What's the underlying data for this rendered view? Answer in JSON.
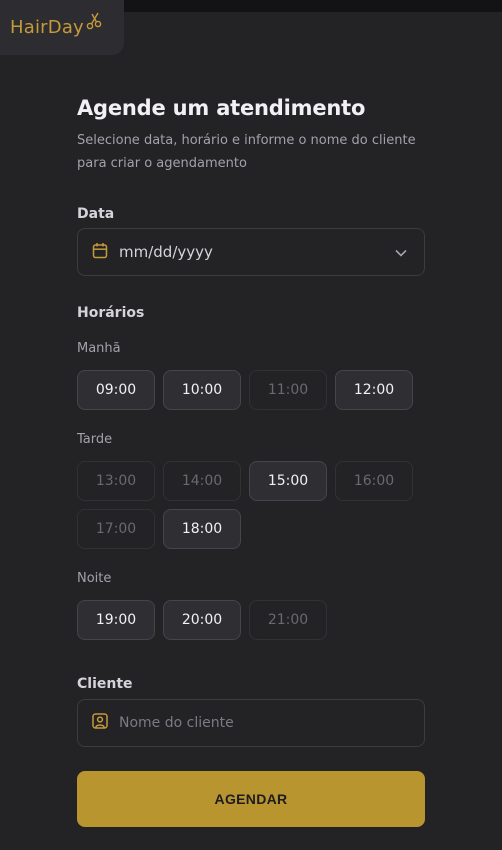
{
  "app": {
    "logo_text": "HairDay"
  },
  "form": {
    "title": "Agende um atendimento",
    "subtitle": "Selecione data, horário e informe o nome do cliente para criar o agendamento",
    "date": {
      "label": "Data",
      "value": "mm/dd/yyyy"
    },
    "hours_label": "Horários",
    "periods": {
      "morning": {
        "label": "Manhã",
        "slots": [
          {
            "time": "09:00",
            "available": true
          },
          {
            "time": "10:00",
            "available": true
          },
          {
            "time": "11:00",
            "available": false
          },
          {
            "time": "12:00",
            "available": true
          }
        ]
      },
      "afternoon": {
        "label": "Tarde",
        "slots": [
          {
            "time": "13:00",
            "available": false
          },
          {
            "time": "14:00",
            "available": false
          },
          {
            "time": "15:00",
            "available": true
          },
          {
            "time": "16:00",
            "available": false
          },
          {
            "time": "17:00",
            "available": false
          },
          {
            "time": "18:00",
            "available": true
          }
        ]
      },
      "night": {
        "label": "Noite",
        "slots": [
          {
            "time": "19:00",
            "available": true
          },
          {
            "time": "20:00",
            "available": true
          },
          {
            "time": "21:00",
            "available": false
          }
        ]
      }
    },
    "client": {
      "label": "Cliente",
      "placeholder": "Nome do cliente"
    },
    "submit_label": "AGENDAR"
  },
  "colors": {
    "accent": "#b8952f",
    "background": "#232225"
  },
  "icons": {
    "calendar": "calendar-icon",
    "chevron": "chevron-down-icon",
    "client": "user-square-icon",
    "scissors": "scissors-icon"
  }
}
